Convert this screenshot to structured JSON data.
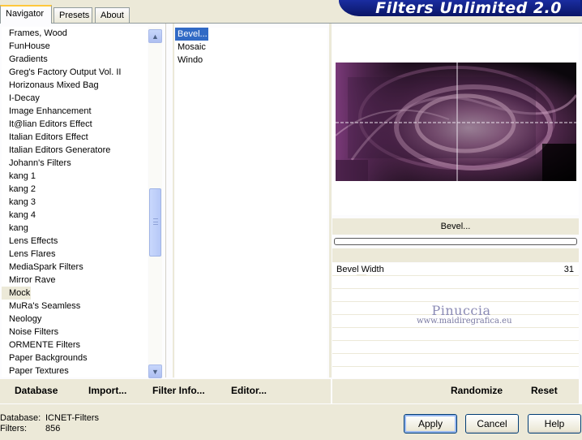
{
  "tabs": [
    {
      "label": "Navigator",
      "active": true
    },
    {
      "label": "Presets",
      "active": false
    },
    {
      "label": "About",
      "active": false
    }
  ],
  "app_title": "Filters Unlimited 2.0",
  "categories": [
    "Frames, Wood",
    "FunHouse",
    "Gradients",
    "Greg's Factory Output Vol. II",
    "Horizonaus Mixed Bag",
    "I-Decay",
    "Image Enhancement",
    "It@lian Editors Effect",
    "Italian Editors Effect",
    "Italian Editors Generatore",
    "Johann's Filters",
    "kang 1",
    "kang 2",
    "kang 3",
    "kang 4",
    "kang",
    "Lens Effects",
    "Lens Flares",
    "MediaSpark Filters",
    "Mirror Rave",
    "Mock",
    "MuRa's Seamless",
    "Neology",
    "Noise Filters",
    "ORMENTE Filters",
    "Paper Backgrounds",
    "Paper Textures"
  ],
  "selected_category": "Mock",
  "filters": [
    "Bevel...",
    "Mosaic",
    "Windo"
  ],
  "selected_filter": "Bevel...",
  "effect_name": "Bevel...",
  "parameters": [
    {
      "label": "Bevel Width",
      "value": "31"
    }
  ],
  "empty_param_rows": 7,
  "watermark": {
    "name": "Pinuccia",
    "url": "www.maidiregrafica.eu"
  },
  "links_left": [
    {
      "label": "Database",
      "name": "database-link"
    },
    {
      "label": "Import...",
      "name": "import-link"
    },
    {
      "label": "Filter Info...",
      "name": "filter-info-link"
    },
    {
      "label": "Editor...",
      "name": "editor-link"
    }
  ],
  "links_right": [
    {
      "label": "Randomize",
      "name": "randomize-link"
    },
    {
      "label": "Reset",
      "name": "reset-link"
    }
  ],
  "status": {
    "database_label": "Database:",
    "database_value": "ICNET-Filters",
    "filters_label": "Filters:",
    "filters_value": "856"
  },
  "buttons": {
    "apply": "Apply",
    "cancel": "Cancel",
    "help": "Help"
  },
  "icons": {
    "scroll_up": "scroll-up-arrow-icon",
    "scroll_down": "scroll-down-arrow-icon",
    "scroll_grip": "scroll-grip-icon"
  },
  "colors": {
    "selection": "#316ac5",
    "banner": "#0f1f7e",
    "tab_highlight": "#ffc83c"
  }
}
